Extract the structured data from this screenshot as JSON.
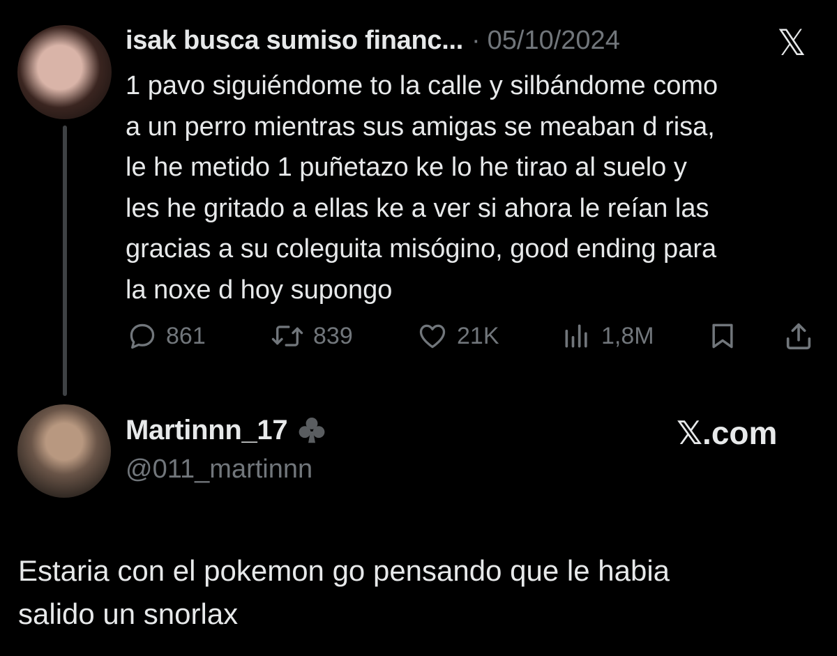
{
  "quoted_tweet": {
    "display_name": "isak busca sumiso financ...",
    "separator": "·",
    "date": "05/10/2024",
    "x_logo": "𝕏",
    "text_lines": [
      "1 pavo siguiéndome to la calle y silbándome como",
      "a un perro mientras sus amigas se meaban d risa,",
      "le he metido 1 puñetazo ke lo he tirao al suelo y",
      "les he gritado a ellas ke a ver si ahora le reían las",
      "gracias a su coleguita misógino, good ending para",
      "la noxe d hoy supongo"
    ],
    "actions": {
      "replies": "861",
      "reposts": "839",
      "likes": "21K",
      "views": "1,8M"
    }
  },
  "reply": {
    "display_name": "Martinnn_17",
    "badge_icon": "club-icon",
    "handle": "@011_martinnn",
    "site_label": "𝕏.com",
    "text_lines": [
      "Estaria con el pokemon go pensando que le habia",
      "salido un snorlax"
    ]
  },
  "colors": {
    "background": "#000000",
    "primary_text": "#e7e9ea",
    "secondary_text": "#71767b",
    "thread_line": "#3e4144"
  }
}
